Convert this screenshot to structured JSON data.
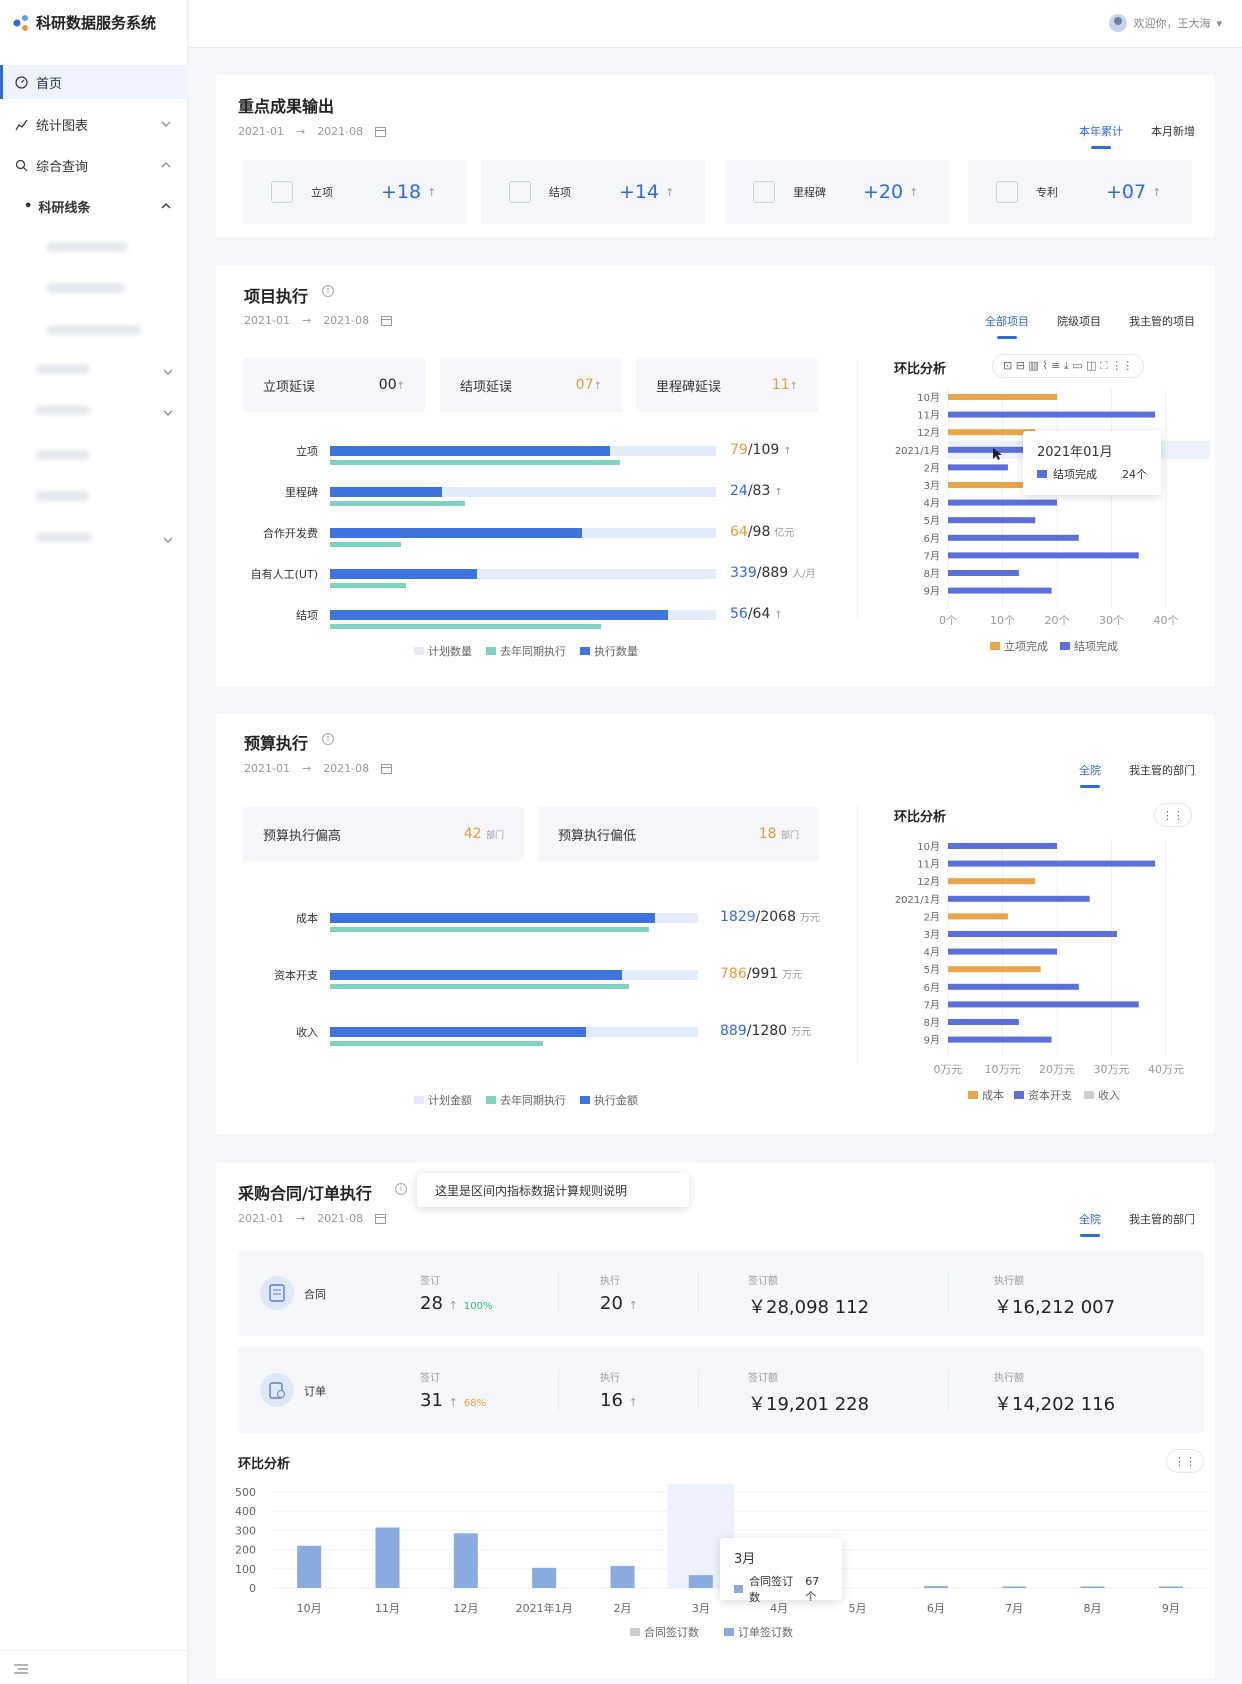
{
  "app": {
    "title": "科研数据服务系统"
  },
  "user": {
    "greeting": "欢迎你，王大海"
  },
  "sidebar": {
    "items": [
      {
        "label": "首页"
      },
      {
        "label": "统计图表"
      },
      {
        "label": "综合查询"
      },
      {
        "label": "科研线条"
      }
    ]
  },
  "output": {
    "title": "重点成果输出",
    "range_start": "2021-01",
    "range_end": "2021-08",
    "tabs": [
      "本年累计",
      "本月新增"
    ],
    "kpis": [
      {
        "label": "立项",
        "value": "+18",
        "icon": "presentation-icon"
      },
      {
        "label": "结项",
        "value": "+14",
        "icon": "board-icon"
      },
      {
        "label": "里程碑",
        "value": "+20",
        "icon": "trophy-icon"
      },
      {
        "label": "专利",
        "value": "+07",
        "icon": "patent-icon"
      }
    ]
  },
  "project": {
    "title": "项目执行",
    "range_start": "2021-01",
    "range_end": "2021-08",
    "tabs": [
      "全部项目",
      "院级项目",
      "我主管的项目"
    ],
    "delays": [
      {
        "label": "立项延误",
        "value": "00"
      },
      {
        "label": "结项延误",
        "value": "07"
      },
      {
        "label": "里程碑延误",
        "value": "11"
      }
    ],
    "rows": [
      {
        "label": "立项",
        "done": "79",
        "total": "/109",
        "unit": "",
        "plan": 109,
        "exec": 79,
        "last": 82
      },
      {
        "label": "里程碑",
        "done": "24",
        "total": "/83",
        "unit": "",
        "plan": 83,
        "exec": 24,
        "last": 29
      },
      {
        "label": "合作开发费",
        "done": "64",
        "total": "/98",
        "unit": "亿元",
        "plan": 98,
        "exec": 64,
        "last": 18
      },
      {
        "label": "自有人工(UT)",
        "done": "339",
        "total": "/889",
        "unit": "人/月",
        "plan": 889,
        "exec": 339,
        "last": 176
      },
      {
        "label": "结项",
        "done": "56",
        "total": "/64",
        "unit": "",
        "plan": 64,
        "exec": 56,
        "last": 45
      }
    ],
    "legend": [
      "计划数量",
      "去年同期执行",
      "执行数量"
    ],
    "chart_title": "环比分析",
    "chart_data": {
      "type": "bar",
      "categories": [
        "10月",
        "11月",
        "12月",
        "2021/1月",
        "2月",
        "3月",
        "4月",
        "5月",
        "6月",
        "7月",
        "8月",
        "9月"
      ],
      "values": [
        20,
        38,
        16,
        24,
        11,
        20,
        20,
        16,
        24,
        35,
        13,
        19
      ],
      "series_of": [
        "立项完成",
        "结项完成",
        "立项完成",
        "结项完成",
        "结项完成",
        "立项完成",
        "结项完成",
        "结项完成",
        "结项完成",
        "结项完成",
        "结项完成",
        "结项完成"
      ],
      "xlim": [
        0,
        40
      ],
      "xticks": [
        "0个",
        "10个",
        "20个",
        "30个",
        "40个"
      ],
      "legend": [
        "立项完成",
        "结项完成"
      ],
      "colors": {
        "立项完成": "#e8a54a",
        "结项完成": "#5b6fd8"
      }
    },
    "tooltip": {
      "title": "2021年01月",
      "series": "结项完成",
      "value": "24个"
    }
  },
  "budget": {
    "title": "预算执行",
    "range_start": "2021-01",
    "range_end": "2021-08",
    "tabs": [
      "全院",
      "我主管的部门"
    ],
    "devs": [
      {
        "label": "预算执行偏高",
        "value": "42",
        "unit": "部门"
      },
      {
        "label": "预算执行偏低",
        "value": "18",
        "unit": "部门"
      }
    ],
    "rows": [
      {
        "label": "成本",
        "done": "1829",
        "total": "/2068",
        "unit": "万元",
        "plan": 2068,
        "exec": 1829,
        "last": 1790
      },
      {
        "label": "资本开支",
        "done": "786",
        "total": "/991",
        "unit": "万元",
        "plan": 991,
        "exec": 786,
        "last": 806
      },
      {
        "label": "收入",
        "done": "889",
        "total": "/1280",
        "unit": "万元",
        "plan": 1280,
        "exec": 889,
        "last": 742
      }
    ],
    "legend": [
      "计划金额",
      "去年同期执行",
      "执行金额"
    ],
    "chart_title": "环比分析",
    "chart_data": {
      "type": "bar",
      "categories": [
        "10月",
        "11月",
        "12月",
        "2021/1月",
        "2月",
        "3月",
        "4月",
        "5月",
        "6月",
        "7月",
        "8月",
        "9月"
      ],
      "values": [
        20,
        38,
        16,
        26,
        11,
        31,
        20,
        17,
        24,
        35,
        13,
        19
      ],
      "series_of": [
        "资本开支",
        "资本开支",
        "成本",
        "资本开支",
        "成本",
        "资本开支",
        "资本开支",
        "成本",
        "资本开支",
        "资本开支",
        "资本开支",
        "资本开支"
      ],
      "xlim": [
        0,
        40
      ],
      "xticks": [
        "0万元",
        "10万元",
        "20万元",
        "30万元",
        "40万元"
      ],
      "legend": [
        "成本",
        "资本开支",
        "收入"
      ],
      "colors": {
        "成本": "#e8a54a",
        "资本开支": "#5b6fd8",
        "收入": "#cccccc"
      }
    }
  },
  "procure": {
    "title": "采购合同/订单执行",
    "note": "这里是区间内指标数据计算规则说明",
    "range_start": "2021-01",
    "range_end": "2021-08",
    "tabs": [
      "全院",
      "我主管的部门"
    ],
    "rows": [
      {
        "name": "合同",
        "sign_k": "签订",
        "sign": "28",
        "pct": "100%",
        "exec_k": "执行",
        "exec": "20",
        "amt_k": "签订额",
        "amt": "￥28,098 112",
        "eamt_k": "执行额",
        "eamt": "￥16,212 007"
      },
      {
        "name": "订单",
        "sign_k": "签订",
        "sign": "31",
        "pct": "68%",
        "exec_k": "执行",
        "exec": "16",
        "amt_k": "签订额",
        "amt": "￥19,201 228",
        "eamt_k": "执行额",
        "eamt": "￥14,202 116"
      }
    ],
    "chart_title": "环比分析",
    "chart_data": {
      "type": "bar",
      "categories": [
        "10月",
        "11月",
        "12月",
        "2021年1月",
        "2月",
        "3月",
        "4月",
        "5月",
        "6月",
        "7月",
        "8月",
        "9月"
      ],
      "series": [
        {
          "name": "合同签订数",
          "values": [
            0,
            0,
            0,
            0,
            0,
            0,
            0,
            0,
            0,
            0,
            0,
            0
          ]
        },
        {
          "name": "订单签订数",
          "values": [
            220,
            315,
            285,
            105,
            115,
            67,
            0,
            0,
            10,
            8,
            8,
            8
          ]
        }
      ],
      "ylim": [
        0,
        500
      ],
      "yticks": [
        "0",
        "100",
        "200",
        "300",
        "400",
        "500"
      ],
      "legend": [
        "合同签订数",
        "订单签订数"
      ],
      "colors": {
        "合同签订数": "#cccccc",
        "订单签订数": "#8aaae0"
      }
    },
    "tooltip": {
      "title": "3月",
      "series": "合同签订数",
      "value": "67个"
    }
  }
}
